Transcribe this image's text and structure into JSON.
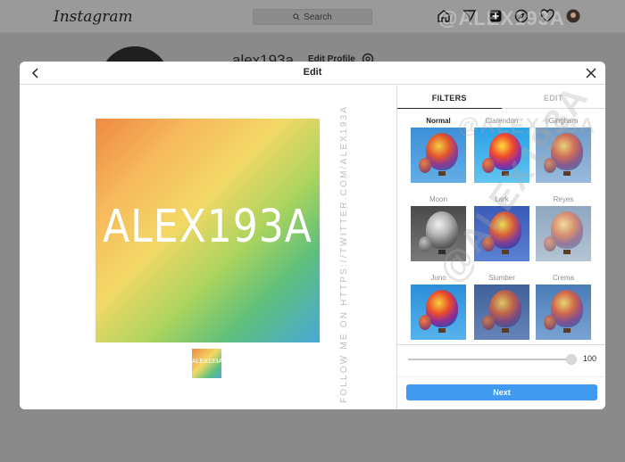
{
  "background": {
    "logo": "Instagram",
    "search_placeholder": "Search",
    "nav_icons": [
      "home-icon",
      "send-icon",
      "new-post-icon",
      "explore-icon",
      "heart-icon",
      "profile-avatar"
    ],
    "username": "alex193a",
    "edit_profile_label": "Edit Profile"
  },
  "modal": {
    "title": "Edit",
    "image_text": "ALEX193A",
    "thumbnail_text": "ALEX193A",
    "tabs": [
      {
        "label": "FILTERS",
        "active": true
      },
      {
        "label": "EDIT",
        "active": false
      }
    ],
    "filters": [
      {
        "name": "Normal",
        "active": true
      },
      {
        "name": "Clarendon",
        "active": false
      },
      {
        "name": "Gingham",
        "active": false
      },
      {
        "name": "Moon",
        "active": false
      },
      {
        "name": "Lark",
        "active": false
      },
      {
        "name": "Reyes",
        "active": false
      },
      {
        "name": "Juno",
        "active": false
      },
      {
        "name": "Slumber",
        "active": false
      },
      {
        "name": "Crema",
        "active": false
      }
    ],
    "slider_value": "100",
    "next_label": "Next"
  },
  "watermarks": {
    "vertical": "FOLLOW ME ON HTTPS://TWITTER.COM/ALEX193A",
    "top": "@ALEX193A",
    "middle": "@ALEX193A",
    "diagonal": "@ALEX193A"
  },
  "colors": {
    "accent": "#3f9af0",
    "overlay": "#8a8a8a"
  }
}
